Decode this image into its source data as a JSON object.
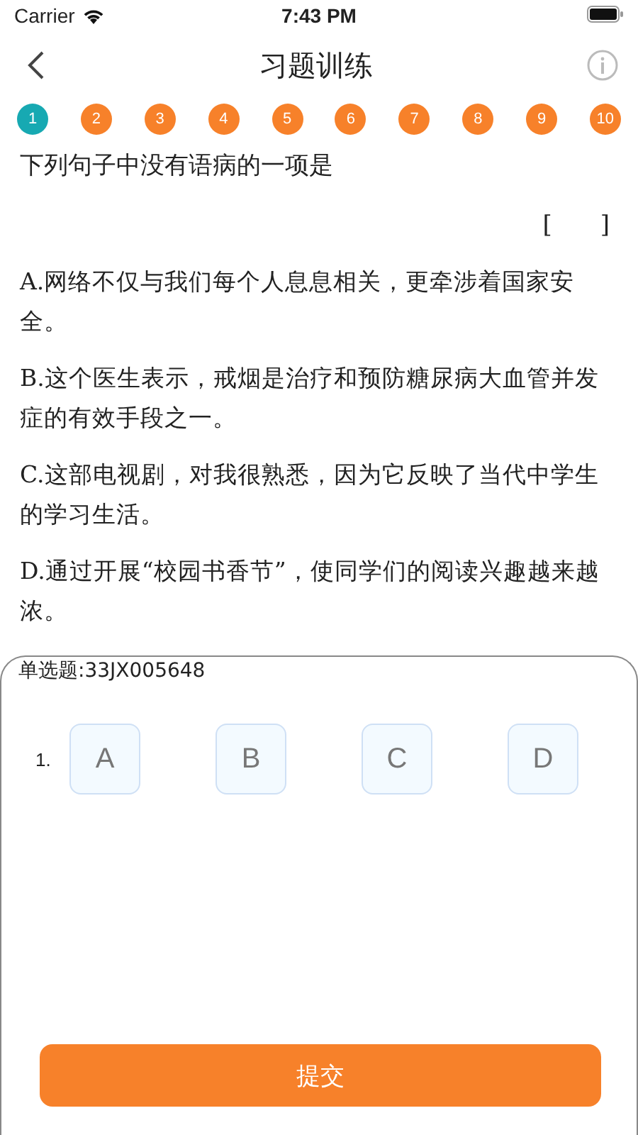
{
  "status_bar": {
    "carrier": "Carrier",
    "time": "7:43 PM"
  },
  "nav": {
    "title": "习题训练"
  },
  "question_numbers": [
    {
      "label": "1",
      "selected": true
    },
    {
      "label": "2",
      "selected": false
    },
    {
      "label": "3",
      "selected": false
    },
    {
      "label": "4",
      "selected": false
    },
    {
      "label": "5",
      "selected": false
    },
    {
      "label": "6",
      "selected": false
    },
    {
      "label": "7",
      "selected": false
    },
    {
      "label": "8",
      "selected": false
    },
    {
      "label": "9",
      "selected": false
    },
    {
      "label": "10",
      "selected": false
    }
  ],
  "question": {
    "stem": "下列句子中没有语病的一项是",
    "blank": "[　　]",
    "options": [
      "A.网络不仅与我们每个人息息相关，更牵涉着国家安全。",
      "B.这个医生表示，戒烟是治疗和预防糖尿病大血管并发症的有效手段之一。",
      "C.这部电视剧，对我很熟悉，因为它反映了当代中学生的学习生活。",
      "D.通过开展“校园书香节”，使同学们的阅读兴趣越来越浓。"
    ]
  },
  "answer_sheet": {
    "heading": "单选题:33JX005648",
    "rows": [
      {
        "number": "1.",
        "choices": [
          {
            "label": "A",
            "selected": false
          },
          {
            "label": "B",
            "selected": false
          },
          {
            "label": "C",
            "selected": false
          },
          {
            "label": "D",
            "selected": false
          }
        ]
      }
    ]
  },
  "submit_button": "提交"
}
